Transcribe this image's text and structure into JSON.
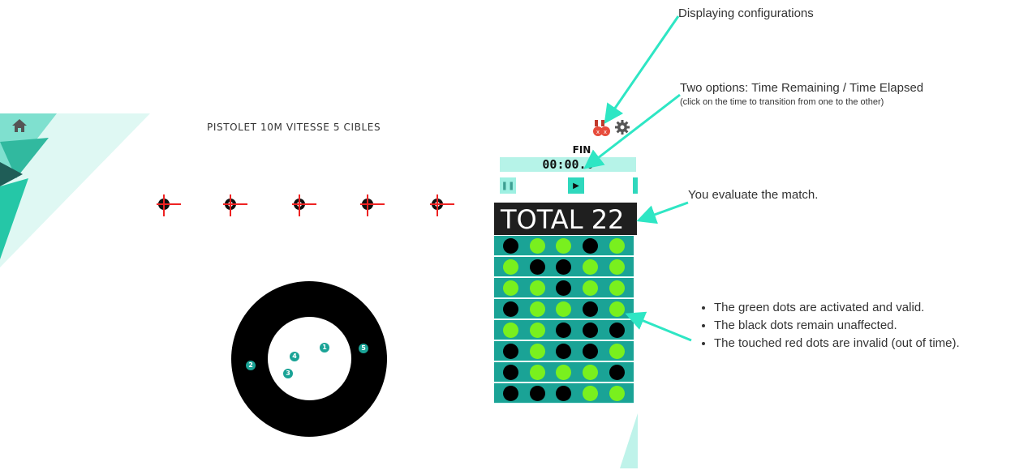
{
  "header": {
    "title": "PISTOLET 10M VITESSE 5 CIBLES"
  },
  "icons": {
    "home": "home-icon",
    "settings": "gear-icon",
    "trophy": "medal-icon"
  },
  "scoreboard": {
    "status": "FIN",
    "time": "00:00.0",
    "total_label": "TOTAL 22",
    "rows": [
      [
        "black",
        "green",
        "green",
        "black",
        "green"
      ],
      [
        "green",
        "black",
        "black",
        "green",
        "green"
      ],
      [
        "green",
        "green",
        "black",
        "green",
        "green"
      ],
      [
        "black",
        "green",
        "green",
        "black",
        "green"
      ],
      [
        "green",
        "green",
        "black",
        "black",
        "black"
      ],
      [
        "black",
        "green",
        "black",
        "black",
        "green"
      ],
      [
        "black",
        "green",
        "green",
        "green",
        "black"
      ],
      [
        "black",
        "black",
        "black",
        "green",
        "green"
      ]
    ]
  },
  "targets": {
    "mini_count": 5,
    "shots": [
      "1",
      "2",
      "3",
      "4",
      "5"
    ]
  },
  "annotations": {
    "configurations": "Displaying configurations",
    "time_options": "Two options: Time Remaining / Time Elapsed",
    "time_options_note": "(click on the time to transition from one to the other)",
    "evaluate": "You evaluate the match.",
    "bullets": [
      "The green dots are activated and valid.",
      "The black dots remain unaffected.",
      "The touched red dots are invalid (out of time)."
    ]
  },
  "colors": {
    "teal_dark": "#1aa396",
    "teal_light": "#b6f3e8",
    "green_dot": "#79f01e",
    "arrow": "#2ee6c4"
  }
}
